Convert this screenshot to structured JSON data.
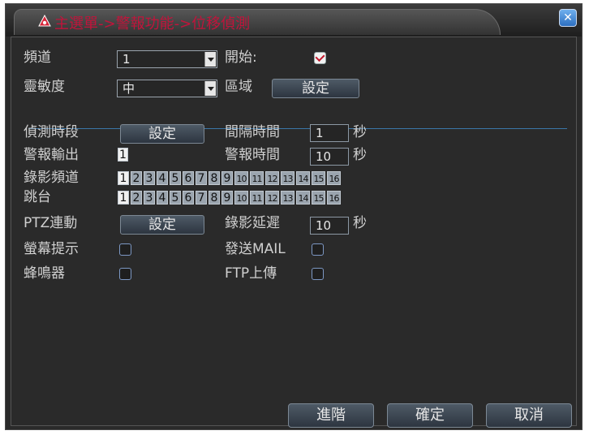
{
  "title": "主選單->警報功能->位移偵測",
  "colors": {
    "title": "#c1143b",
    "separator": "#3b77a8",
    "close": "#2d6fc0"
  },
  "row1": {
    "channel_label": "頻道",
    "channel_value": "1",
    "start_label": "開始:",
    "start_checked": true
  },
  "row2": {
    "sensitivity_label": "靈敏度",
    "sensitivity_value": "中",
    "region_label": "區域",
    "region_button": "設定"
  },
  "detect_period": {
    "label": "偵測時段",
    "button": "設定"
  },
  "interval": {
    "label": "間隔時間",
    "value": "1",
    "unit": "秒"
  },
  "alarm_out": {
    "label": "警報輸出",
    "value": "1"
  },
  "alarm_time": {
    "label": "警報時間",
    "value": "10",
    "unit": "秒"
  },
  "record_channel": {
    "label": "錄影頻道",
    "channels": [
      "1",
      "2",
      "3",
      "4",
      "5",
      "6",
      "7",
      "8",
      "9",
      "10",
      "11",
      "12",
      "13",
      "14",
      "15",
      "16"
    ]
  },
  "tour": {
    "label": "跳台",
    "channels": [
      "1",
      "2",
      "3",
      "4",
      "5",
      "6",
      "7",
      "8",
      "9",
      "10",
      "11",
      "12",
      "13",
      "14",
      "15",
      "16"
    ]
  },
  "ptz": {
    "label": "PTZ連動",
    "button": "設定"
  },
  "record_delay": {
    "label": "錄影延遲",
    "value": "10",
    "unit": "秒"
  },
  "screen_prompt": {
    "label": "螢幕提示",
    "checked": false
  },
  "send_mail": {
    "label": "發送MAIL",
    "checked": false
  },
  "buzzer": {
    "label": "蜂鳴器",
    "checked": false
  },
  "ftp_upload": {
    "label": "FTP上傳",
    "checked": false
  },
  "buttons": {
    "advanced": "進階",
    "ok": "確定",
    "cancel": "取消"
  }
}
